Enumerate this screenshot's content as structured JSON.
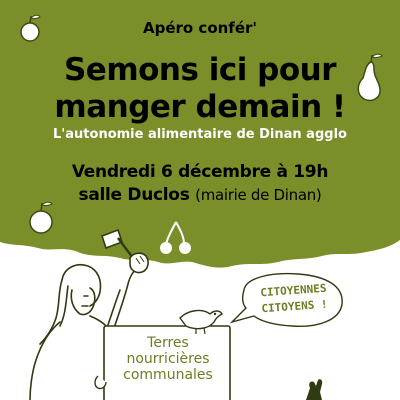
{
  "event": {
    "kicker": "Apéro confér'",
    "headline_line1": "Semons ici pour",
    "headline_line2": "manger demain !",
    "tagline": "L'autonomie alimentaire de Dinan agglo",
    "date": "Vendredi 6 décembre à 19h",
    "venue": "salle Duclos",
    "venue_detail": "(mairie de Dinan)"
  },
  "illustration": {
    "sign_lines": [
      "Terres",
      "nourricières",
      "communales"
    ],
    "speech_lines": [
      "CITOYENNES",
      "CITOYENS !"
    ]
  },
  "colors": {
    "olive": "#7a8f2a",
    "ink": "#000000",
    "white": "#ffffff"
  },
  "icons": [
    "apple-icon",
    "pear-icon",
    "cherries-icon",
    "bird-icon",
    "hammer-icon",
    "hand-icon"
  ]
}
